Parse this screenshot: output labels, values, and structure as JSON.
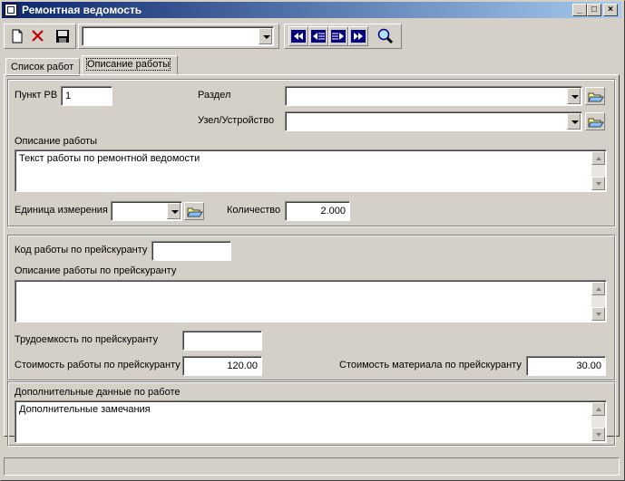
{
  "window": {
    "title": "Ремонтная ведомость"
  },
  "toolbar": {
    "combo_value": "",
    "buttons": [
      "new-icon",
      "delete-icon",
      "save-icon",
      "first-record-icon",
      "prev-record-icon",
      "next-record-icon",
      "last-record-icon",
      "search-icon"
    ]
  },
  "tabs": [
    {
      "label": "Список работ",
      "active": false
    },
    {
      "label": "Описание работы",
      "active": true
    }
  ],
  "form": {
    "punkt_label": "Пункт РВ",
    "punkt_value": "1",
    "razdel_label": "Раздел",
    "razdel_value": "",
    "uzel_label": "Узел/Устройство",
    "uzel_value": "",
    "desc_label": "Описание работы",
    "desc_value": "Текст работы по ремонтной ведомости",
    "unit_label": "Единица измерения",
    "unit_value": "",
    "qty_label": "Количество",
    "qty_value": "2.000",
    "price_code_label": "Код работы по прейскуранту",
    "price_code_value": "",
    "price_desc_label": "Описание работы по прейскуранту",
    "price_desc_value": "",
    "labor_label": "Трудоемкость по прейскуранту",
    "labor_value": "",
    "work_cost_label": "Стоимость работы по прейскуранту",
    "work_cost_value": "120.00",
    "material_cost_label": "Стоимость материала по прейскуранту",
    "material_cost_value": "30.00",
    "extra_label": "Дополнительные данные по работе",
    "extra_value": "Дополнительные замечания"
  },
  "colors": {
    "title_start": "#0a246a",
    "title_end": "#a6caf0",
    "face": "#d4d0c8",
    "nav_icon": "#000080"
  }
}
